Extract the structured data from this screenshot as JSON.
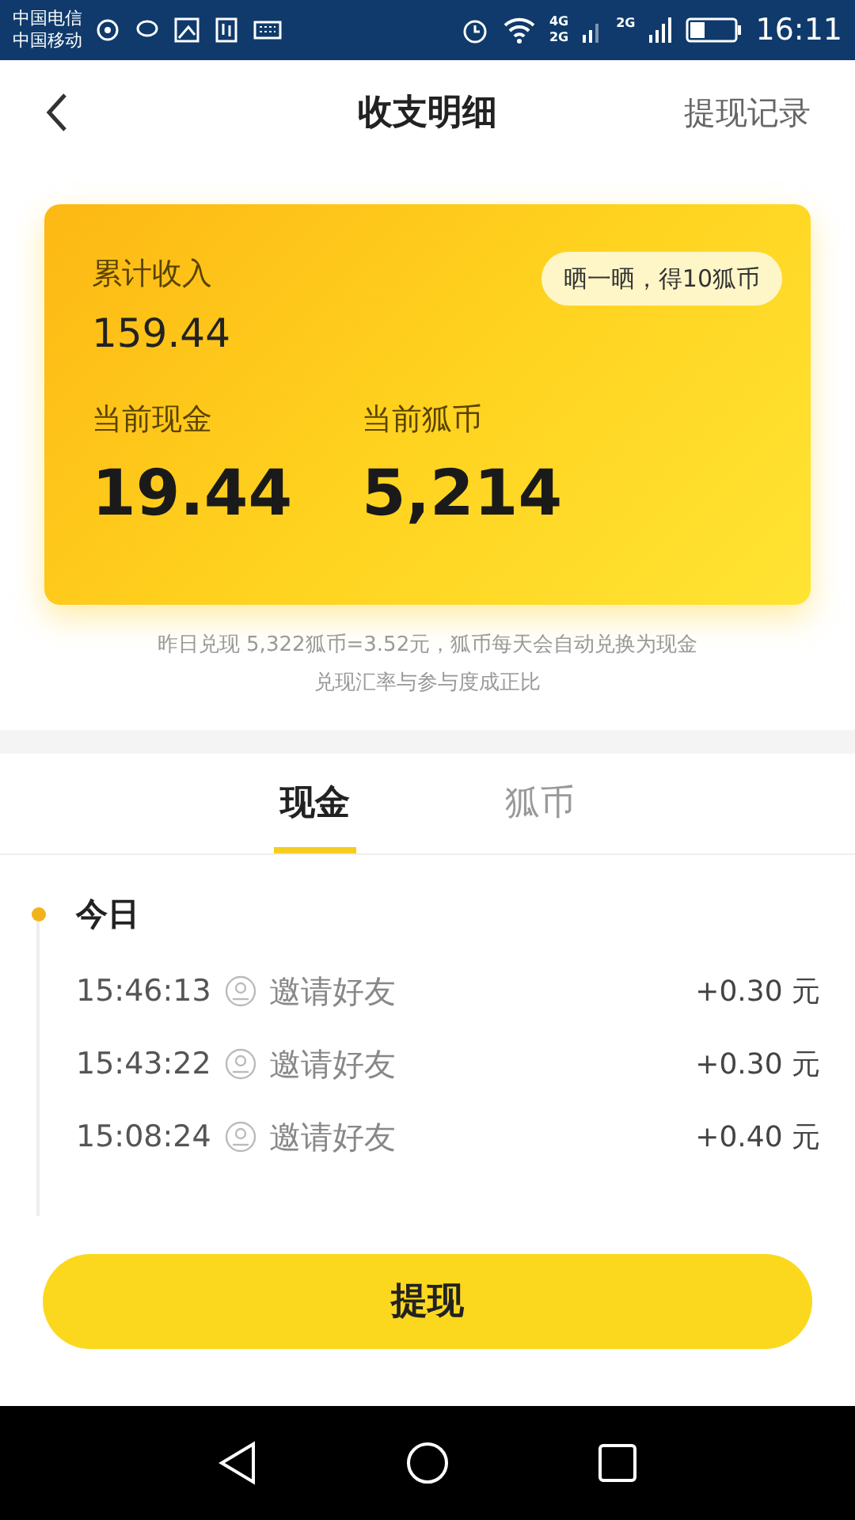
{
  "status_bar": {
    "carriers": [
      "中国电信",
      "中国移动"
    ],
    "network_labels": [
      "4G",
      "2G",
      "2G"
    ],
    "time": "16:11"
  },
  "header": {
    "title": "收支明细",
    "action": "提现记录"
  },
  "summary_card": {
    "total_label": "累计收入",
    "total_value": "159.44",
    "share_button": "晒一晒，得10狐币",
    "stats": [
      {
        "label": "当前现金",
        "value": "19.44"
      },
      {
        "label": "当前狐币",
        "value": "5,214"
      }
    ]
  },
  "notes": [
    "昨日兑现 5,322狐币=3.52元，狐币每天会自动兑换为现金",
    "兑现汇率与参与度成正比"
  ],
  "tabs": [
    {
      "label": "现金",
      "selected": true
    },
    {
      "label": "狐币",
      "selected": false
    }
  ],
  "timeline": {
    "day": "今日",
    "records": [
      {
        "time": "15:46:13",
        "title": "邀请好友",
        "amount": "+0.30 元"
      },
      {
        "time": "15:43:22",
        "title": "邀请好友",
        "amount": "+0.30 元"
      },
      {
        "time": "15:08:24",
        "title": "邀请好友",
        "amount": "+0.40 元"
      }
    ]
  },
  "withdraw_button": "提现"
}
